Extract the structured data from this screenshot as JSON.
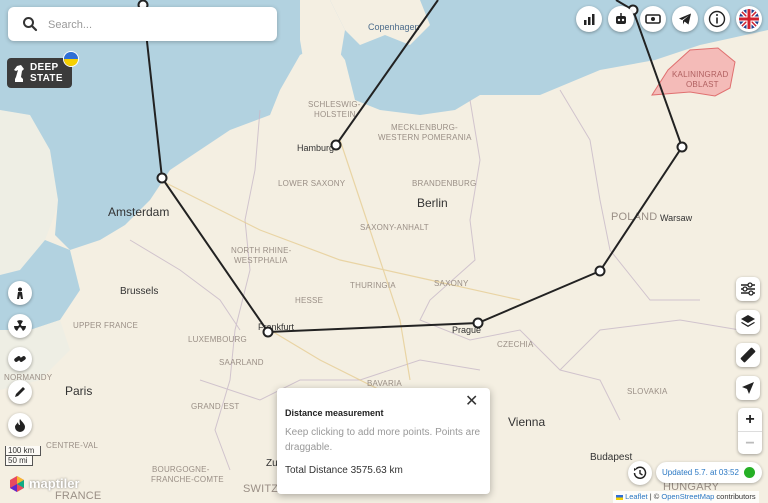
{
  "search": {
    "placeholder": "Search..."
  },
  "logo": {
    "line1": "DEEP",
    "line2": "STATE"
  },
  "labels": {
    "seas": [
      "Copenhagen"
    ],
    "cities": {
      "amsterdam": "Amsterdam",
      "berlin": "Berlin",
      "hamburg": "Hamburg",
      "brussels": "Brussels",
      "paris": "Paris",
      "frankfurt": "Frankfurt",
      "prague": "Prague",
      "vienna": "Vienna",
      "warsaw": "Warsaw",
      "budapest": "Budapest",
      "zurich": "Zu"
    },
    "regions": {
      "schleswig1": "SCHLESWIG-",
      "schleswig2": "HOLSTEIN",
      "meck1": "MECKLENBURG-",
      "meck2": "WESTERN POMERANIA",
      "lowersaxony": "LOWER SAXONY",
      "brandenburg": "BRANDENBURG",
      "saxonyanhalt": "SAXONY-ANHALT",
      "nrw1": "NORTH RHINE-",
      "nrw2": "WESTPHALIA",
      "hesse": "HESSE",
      "thuringia": "THURINGIA",
      "saxony": "SAXONY",
      "upperfrance": "UPPER FRANCE",
      "luxembourg": "LUXEMBOURG",
      "saarland": "SAARLAND",
      "grandest": "GRAND EST",
      "bavaria": "BAVARIA",
      "czechia": "CZECHIA",
      "slovakia": "SLOVAKIA",
      "normandy": "NORMANDY",
      "centreval": "CENTRE-VAL",
      "bourgogne1": "BOURGOGNE-",
      "bourgogne2": "FRANCHE-COMTE",
      "france": "FRANCE",
      "switz": "SWITZ",
      "poland": "POLAND",
      "hungary": "HUNGARY",
      "kaliningrad1": "KALININGRAD",
      "kaliningrad2": "OBLAST"
    }
  },
  "top_buttons": [
    "chart-icon",
    "bot-icon",
    "money-icon",
    "telegram-icon",
    "info-icon",
    "uk-flag-icon"
  ],
  "left_buttons": [
    "person-icon",
    "radiation-icon",
    "link-icon",
    "pen-icon",
    "fire-icon"
  ],
  "right_buttons": [
    "sliders-icon",
    "layers-icon",
    "ruler-icon",
    "locate-icon"
  ],
  "zoom": {
    "in": "+",
    "out": "−"
  },
  "popup": {
    "title": "Distance measurement",
    "close": "✕",
    "hint": "Keep clicking to add more points. Points are draggable.",
    "total": "Total Distance 3575.63 km"
  },
  "scale": {
    "km": "100 km",
    "mi": "50 mi"
  },
  "maptiler": "maptiler",
  "updated": "Updated 5.7. at 03:52",
  "attribution": {
    "leaflet": "Leaflet",
    "sep": " | © ",
    "osm": "OpenStreetMap",
    "suffix": " contributors"
  },
  "colors": {
    "line": "#222222",
    "kaliningrad_fill": "#f4a9a9",
    "kaliningrad_stroke": "#e07070",
    "status": "#26b026"
  }
}
